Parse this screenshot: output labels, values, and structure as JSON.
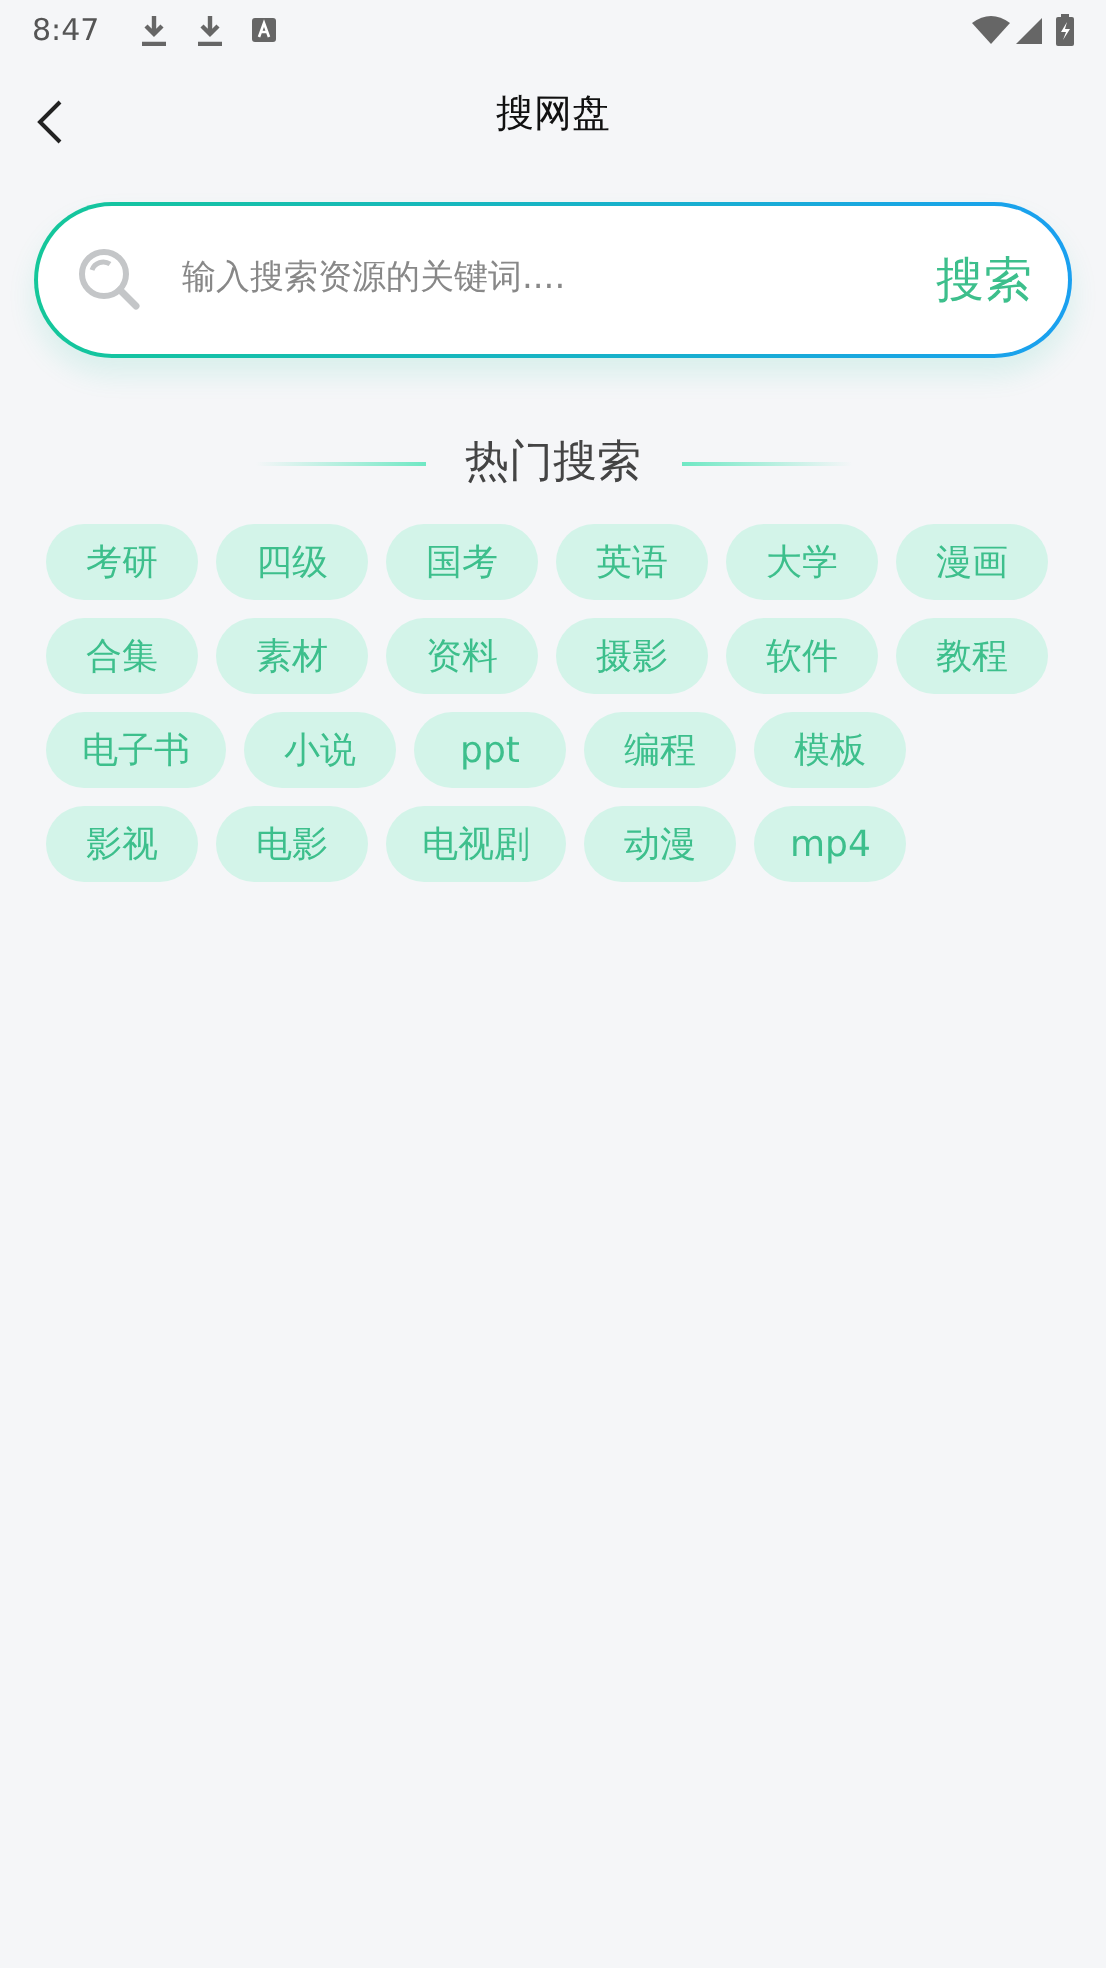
{
  "status_bar": {
    "time": "8:47"
  },
  "header": {
    "title": "搜网盘"
  },
  "search": {
    "placeholder": "输入搜索资源的关键词....",
    "button": "搜索"
  },
  "hot": {
    "title": "热门搜索",
    "rows": [
      [
        "考研",
        "四级",
        "国考",
        "英语",
        "大学",
        "漫画"
      ],
      [
        "合集",
        "素材",
        "资料",
        "摄影",
        "软件",
        "教程"
      ],
      [
        "电子书",
        "小说",
        "ppt",
        "编程",
        "模板"
      ],
      [
        "影视",
        "电影",
        "电视剧",
        "动漫",
        "mp4"
      ]
    ]
  }
}
